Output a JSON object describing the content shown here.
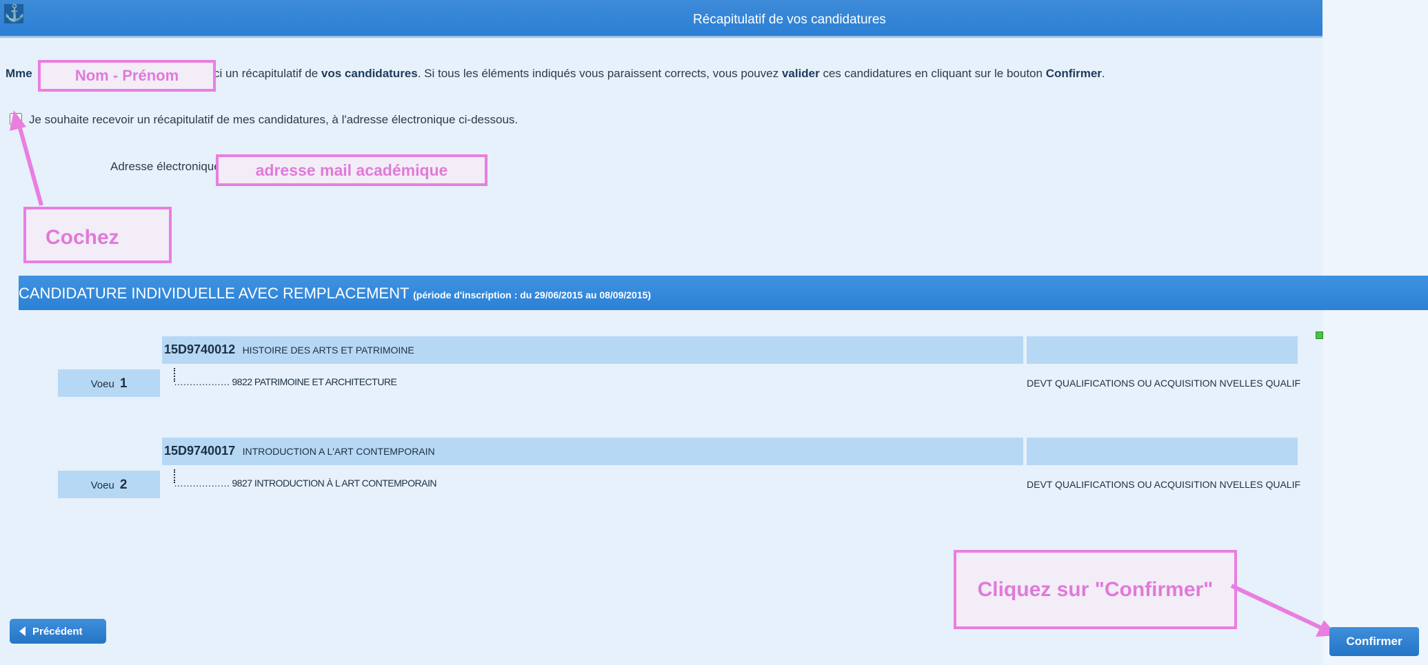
{
  "header": {
    "logo_icon": "⚓",
    "title": "Récapitulatif de vos candidatures"
  },
  "intro": {
    "salutation": "Mme",
    "name_placeholder": "Nom - Prénom",
    "text_before_vos": "oici un récapitulatif de ",
    "vos_candidatures": "vos candidatures",
    "text_middle": ". Si tous les éléments indiqués vous paraissent corrects, vous pouvez ",
    "valider": "valider",
    "text_after_valider": " ces candidatures en cliquant sur le bouton ",
    "confirmer": "Confirmer",
    "end": "."
  },
  "email_option": {
    "checkbox_label": "Je souhaite recevoir un récapitulatif de mes candidatures, à l'adresse électronique ci-dessous.",
    "checked": false,
    "address_label": "Adresse électronique :",
    "address_value": "adresse mail académique"
  },
  "annotations": {
    "cochez": "Cochez",
    "cliquez": "Cliquez sur \"Confirmer\"",
    "highlight_color": "#e97ee0"
  },
  "section": {
    "title": "CANDIDATURE INDIVIDUELLE AVEC REMPLACEMENT",
    "period": "(période d'inscription : du 29/06/2015 au 08/09/2015)"
  },
  "wishes": [
    {
      "voeu_label": "Voeu",
      "number": "1",
      "code": "15D9740012",
      "formation": "HISTOIRE DES ARTS ET PATRIMOINE",
      "tree": "……………… 9822 PATRIMOINE ET ARCHITECTURE",
      "category": "DEVT QUALIFICATIONS OU ACQUISITION NVELLES QUALIF"
    },
    {
      "voeu_label": "Voeu",
      "number": "2",
      "code": "15D9740017",
      "formation": "INTRODUCTION A L'ART CONTEMPORAIN",
      "tree": "……………… 9827 INTRODUCTION À L ART CONTEMPORAIN",
      "category": "DEVT QUALIFICATIONS OU ACQUISITION NVELLES QUALIF"
    }
  ],
  "buttons": {
    "previous": "Précédent",
    "confirm": "Confirmer"
  },
  "colors": {
    "header": "#2c7fd4",
    "row": "#b6d8f5",
    "background": "#e6f1fb"
  }
}
